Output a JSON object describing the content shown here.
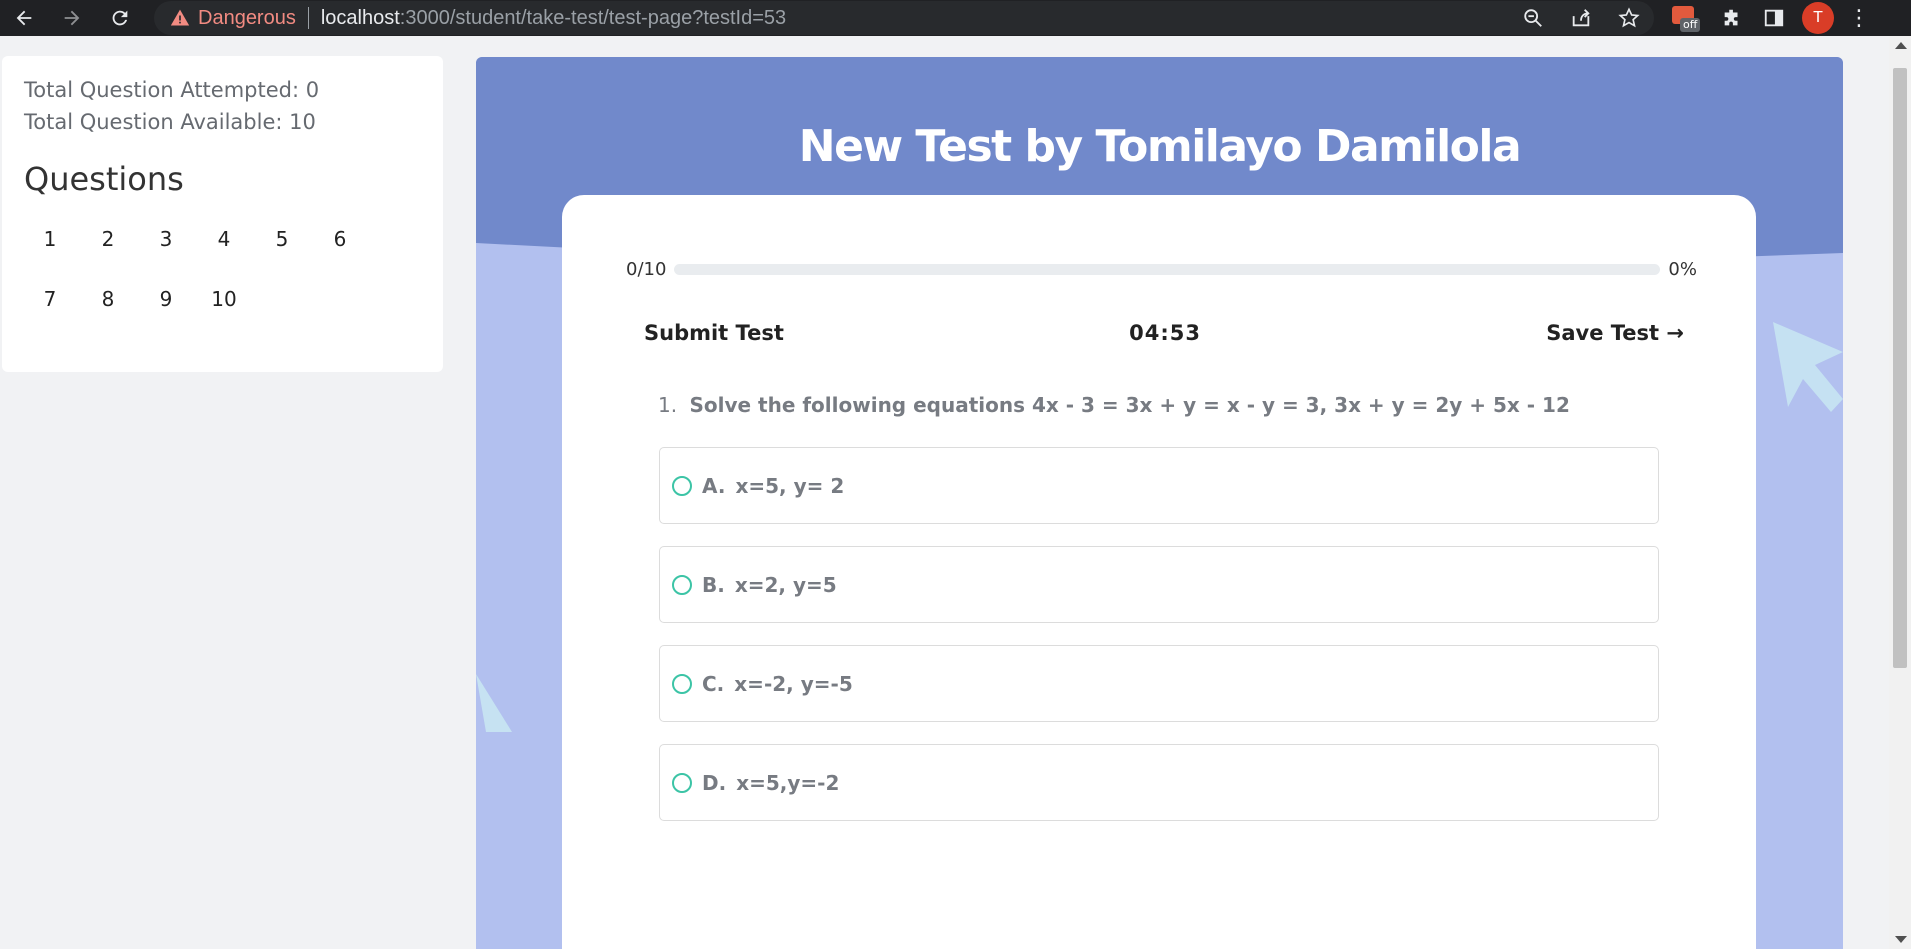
{
  "browser": {
    "security_label": "Dangerous",
    "url_host": "localhost",
    "url_path": ":3000/student/take-test/test-page?testId=53",
    "extension_badge": "off",
    "profile_initial": "T"
  },
  "sidebar": {
    "attempted_label": "Total Question Attempted: 0",
    "available_label": "Total Question Available: 10",
    "heading": "Questions",
    "question_numbers": [
      "1",
      "2",
      "3",
      "4",
      "5",
      "6",
      "7",
      "8",
      "9",
      "10"
    ]
  },
  "test": {
    "title": "New Test by Tomilayo Damilola",
    "progress_count": "0/10",
    "progress_percent": "0%",
    "progress_fraction": 0,
    "submit_label": "Submit Test",
    "timer": "04:53",
    "save_label": "Save Test →",
    "question_number": "1.",
    "question_text": "Solve the following equations 4x - 3 = 3x + y = x - y = 3, 3x + y = 2y + 5x - 12",
    "options": [
      {
        "letter": "A.",
        "text": "x=5, y= 2"
      },
      {
        "letter": "B.",
        "text": "x=2, y=5"
      },
      {
        "letter": "C.",
        "text": "x=-2, y=-5"
      },
      {
        "letter": "D.",
        "text": "x=5,y=-2"
      }
    ]
  },
  "colors": {
    "header_band": "#7189cb",
    "background_band": "#b2c0ef",
    "radio_accent": "#3cc4a6",
    "danger": "#f28b82"
  }
}
